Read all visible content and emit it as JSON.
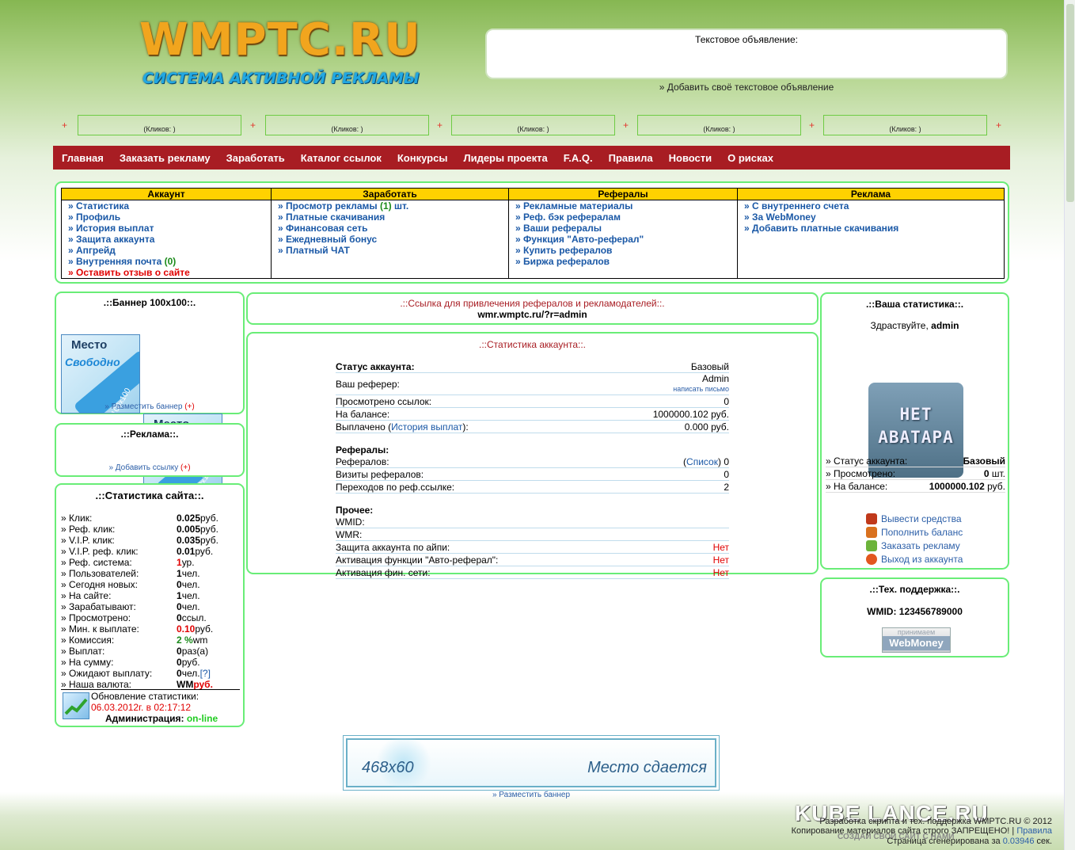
{
  "header": {
    "logo_title": "WMPTC.RU",
    "logo_subtitle": "СИСТЕМА АКТИВНОЙ РЕКЛАМЫ",
    "textad_label": "Текстовое объявление:",
    "textad_add": "» Добавить своё текстовое объявление",
    "slots": [
      "(Кликов: )",
      "(Кликов: )",
      "(Кликов: )",
      "(Кликов: )",
      "(Кликов: )"
    ],
    "plus": "+"
  },
  "nav": [
    "Главная",
    "Заказать рекламу",
    "Заработать",
    "Каталог ссылок",
    "Конкурсы",
    "Лидеры проекта",
    "F.A.Q.",
    "Правила",
    "Новости",
    "О рисках"
  ],
  "menu": {
    "account": {
      "title": "Аккаунт",
      "items": [
        "» Статистика",
        "» Профиль",
        "» История выплат",
        "» Защита аккаунта",
        "» Апгрейд",
        "» Внутренняя почта "
      ],
      "mail_count": "(0)",
      "feedback": "» Оставить отзыв о сайте"
    },
    "earn": {
      "title": "Заработать",
      "view_ads": "» Просмотр рекламы ",
      "view_count": "(1)",
      "view_unit": " шт.",
      "items": [
        "» Платные скачивания",
        "» Финансовая сеть",
        "» Ежедневный бонус",
        "» Платный ЧАТ"
      ]
    },
    "refs": {
      "title": "Рефералы",
      "items": [
        "» Рекламные материалы",
        "» Реф. бэк рефералам",
        "» Ваши рефералы",
        "» Функция \"Авто-реферал\"",
        "» Купить рефералов",
        "» Биржа рефералов"
      ]
    },
    "ads": {
      "title": "Реклама",
      "items": [
        "» С внутреннего счета",
        "» За WebMoney",
        "» Добавить платные скачивания"
      ]
    }
  },
  "left": {
    "banner_title": ".::Баннер 100x100::.",
    "banner_text1": "Место",
    "banner_text2": "Свободно",
    "banner_num": "100x100",
    "banner_place": "» Разместить баннер ",
    "plus": "(+)",
    "ads_title": ".::Реклама::.",
    "ads_add": "» Добавить ссылку ",
    "stats_title": ".::Статистика сайта::.",
    "stats": [
      {
        "label": "» Клик:",
        "value": "0.025",
        "unit": " руб.",
        "color": "#000"
      },
      {
        "label": "» Реф. клик:",
        "value": "0.005",
        "unit": " руб.",
        "color": "#000"
      },
      {
        "label": "» V.I.P. клик:",
        "value": "0.035",
        "unit": " руб.",
        "color": "#000"
      },
      {
        "label": "» V.I.P. реф. клик:",
        "value": "0.01",
        "unit": " руб.",
        "color": "#000"
      },
      {
        "label": "» Реф. система:",
        "value": "1",
        "unit": " ур.",
        "color": "#e00000"
      },
      {
        "label": "» Пользователей:",
        "value": "1",
        "unit": " чел.",
        "color": "#000"
      },
      {
        "label": "» Сегодня новых:",
        "value": "0",
        "unit": " чел.",
        "color": "#000"
      },
      {
        "label": "» На сайте:",
        "value": "1",
        "unit": " чел.",
        "color": "#000"
      },
      {
        "label": "» Зарабатывают:",
        "value": "0",
        "unit": " чел.",
        "color": "#000"
      },
      {
        "label": "» Просмотрено:",
        "value": "0",
        "unit": " ссыл.",
        "color": "#000"
      },
      {
        "label": "» Мин. к выплате:",
        "value": "0.10",
        "unit": " руб.",
        "color": "#e00000"
      },
      {
        "label": "» Комиссия:",
        "value": "2 %",
        "unit": " wm",
        "color": "#1a8a1a"
      },
      {
        "label": "» Выплат:",
        "value": "0",
        "unit": " раз(а)",
        "color": "#000"
      },
      {
        "label": "» На сумму:",
        "value": "0",
        "unit": " руб.",
        "color": "#000"
      },
      {
        "label": "» Ожидают выплату:",
        "value": "0",
        "unit": " чел. ",
        "color": "#000"
      },
      {
        "label": "» Наша валюта:",
        "value": "WM",
        "unit": "руб.",
        "color": "#000"
      }
    ],
    "help": "[?]",
    "update_label": "Обновление статистики:",
    "update_time": "06.03.2012г. в 02:17:12",
    "admin_label": "Администрация: ",
    "admin_status": "on-line"
  },
  "center": {
    "ref_link_title": ".::Ссылка для привлечения рефералов и рекламодателей::.",
    "ref_link": "wmr.wmptc.ru/?r=admin",
    "acc_title": ".::Статистика аккаунта::.",
    "status_label": "Статус аккаунта:",
    "status_value": "Базовый",
    "referer_label": "Ваш реферер:",
    "referer_value": "Admin",
    "referer_mail": "написать письмо",
    "viewed_label": "Просмотрено ссылок:",
    "viewed_value": "0",
    "balance_label": "На балансе:",
    "balance_value": "1000000.102 руб.",
    "paid_label_a": "Выплачено (",
    "paid_link": "История выплат",
    "paid_label_b": "):",
    "paid_value": "0.000 руб.",
    "refs_title": "Рефералы:",
    "refs_label": "Рефералов:",
    "refs_list": "Список",
    "refs_value": "0",
    "ref_visits_label": "Визиты рефералов:",
    "ref_visits_value": "0",
    "ref_clicks_label": "Переходов по реф.ссылке:",
    "ref_clicks_value": "2",
    "other_title": "Прочее:",
    "wmid_label": "WMID:",
    "wmr_label": "WMR:",
    "ip_label": "Защита аккаунта по айпи:",
    "ip_value": "Нет",
    "auto_label": "Активация функции \"Авто-реферал\":",
    "auto_value": "Нет",
    "fin_label": "Активация фин. сети:",
    "fin_value": "Нет",
    "banner468_size": "468x60",
    "banner468_text": "Место сдается",
    "banner468_place": "» Разместить баннер"
  },
  "right": {
    "title": ".::Ваша статистика::.",
    "greeting": "Здраствуйте, ",
    "username": "admin",
    "avatar_line1": "НЕТ",
    "avatar_line2": "АВАТАРА",
    "status_label": "» Статус аккаунта:",
    "status_value": "Базовый",
    "viewed_label": "» Просмотрено:",
    "viewed_value": "0",
    "viewed_unit": " шт.",
    "balance_label": "» На балансе:",
    "balance_value": "1000000.102",
    "balance_unit": " руб.",
    "links": [
      "Вывести средства",
      "Пополнить баланс",
      "Заказать рекламу",
      "Выход из аккаунта"
    ],
    "support_title": ".::Тех. поддержка::.",
    "wmid": "WMID: 123456789000",
    "wm_badge_top": "принимаем",
    "wm_badge": "WebMoney"
  },
  "footer": {
    "line1": "Разработка скрипта и тех. поддержка WMPTC.RU © 2012",
    "line2a": "Копирование материалов сайта строго ЗАПРЕЩЕНО! | ",
    "line2b": "Правила",
    "line3a": "Страница сгенерирована за ",
    "line3b": "0.03946",
    "line3c": " сек.",
    "watermark": "KUBE LANCE.RU",
    "watermark_sub": "СОЗДАЙ СВОЙ САЙТ С НАМИ"
  },
  "colors": {
    "nav": "#a81d23",
    "box_border": "#69ed77",
    "menu_header": "#ffd100",
    "link": "#1a58a6",
    "red": "#e00000"
  }
}
